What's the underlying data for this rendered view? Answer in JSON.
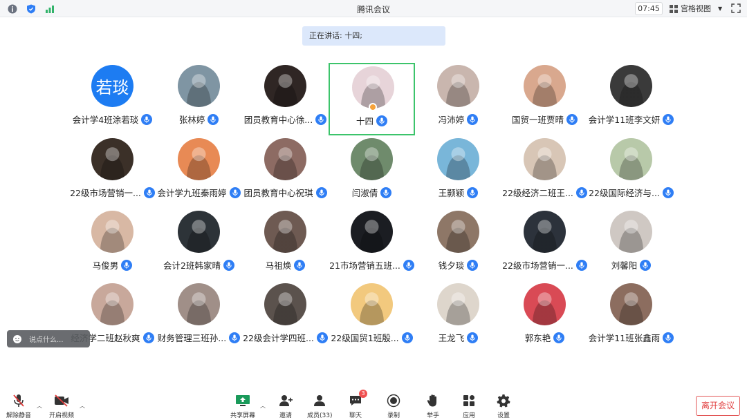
{
  "titlebar": {
    "title": "腾讯会议",
    "time": "07:45",
    "view_label": "宫格视图"
  },
  "speaking": {
    "text": "正在讲话: 十四;"
  },
  "participants": [
    {
      "name": "会计学4班涂若琰",
      "avatar_text": "若琰",
      "color": "#1d7cf2"
    },
    {
      "name": "张林婷",
      "color": "#7f95a3"
    },
    {
      "name": "团员教育中心徐...",
      "color": "#2f2624"
    },
    {
      "name": "十四",
      "color": "#e7d4d9",
      "active": true
    },
    {
      "name": "冯沛婷",
      "color": "#c9b6ae"
    },
    {
      "name": "国贸一班贾晴",
      "color": "#d9a88e"
    },
    {
      "name": "会计学11班李文妍",
      "color": "#3a3a3a"
    },
    {
      "name": "22级市场营销一...",
      "color": "#3b3028"
    },
    {
      "name": "会计学九班秦雨婷",
      "color": "#e88a55"
    },
    {
      "name": "团员教育中心祝琪",
      "color": "#8d6b63"
    },
    {
      "name": "闫淑倩",
      "color": "#6f8b6c"
    },
    {
      "name": "王颢颖",
      "color": "#79b6d9"
    },
    {
      "name": "22级经济二班王...",
      "color": "#d8c6b6"
    },
    {
      "name": "22级国际经济与...",
      "color": "#b8c9a9"
    },
    {
      "name": "马俊男",
      "color": "#d8b8a4"
    },
    {
      "name": "会计2班韩家晴",
      "color": "#2d3338"
    },
    {
      "name": "马祖焕",
      "color": "#6e5a52"
    },
    {
      "name": "21市场营销五班...",
      "color": "#1b1d22"
    },
    {
      "name": "钱夕琰",
      "color": "#8e7767"
    },
    {
      "name": "22级市场营销一...",
      "color": "#2c323b"
    },
    {
      "name": "刘馨阳",
      "color": "#cfc8c3"
    },
    {
      "name": "经济学二班赵秋爽",
      "color": "#c8a89b"
    },
    {
      "name": "财务管理三班孙...",
      "color": "#a08f88"
    },
    {
      "name": "22级会计学四班...",
      "color": "#5b524d"
    },
    {
      "name": "22级国贸1班殷...",
      "color": "#f2c97e"
    },
    {
      "name": "王龙飞",
      "color": "#ded6cc"
    },
    {
      "name": "郭东艳",
      "color": "#d94a55"
    },
    {
      "name": "会计学11班张鑫雨",
      "color": "#8c6d5f"
    }
  ],
  "chat": {
    "placeholder": "说点什么..."
  },
  "toolbar": {
    "unmute": "解除静音",
    "start_video": "开启视频",
    "share": "共享屏幕",
    "invite": "邀请",
    "members": "成员(33)",
    "chat": "聊天",
    "chat_badge": "3",
    "record": "录制",
    "raise_hand": "举手",
    "apps": "应用",
    "settings": "设置",
    "leave": "离开会议"
  }
}
